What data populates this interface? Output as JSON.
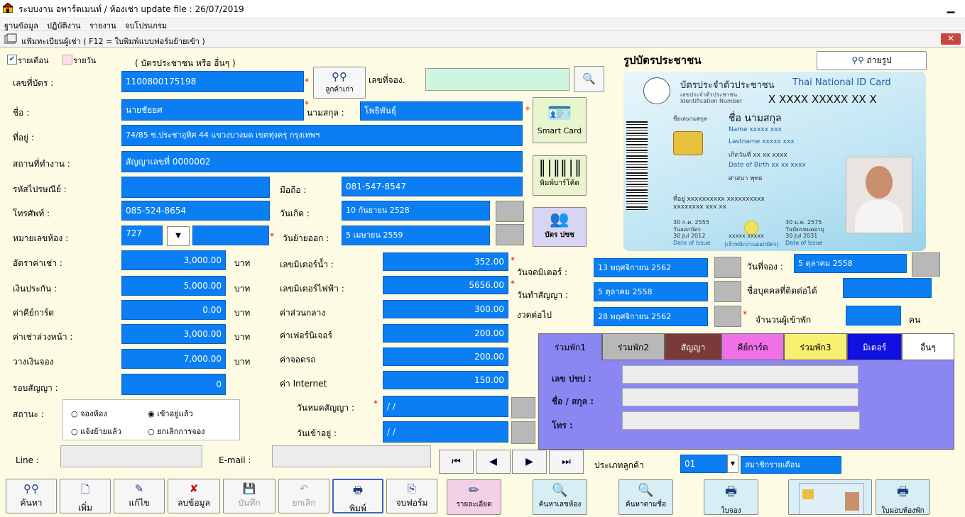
{
  "window": {
    "title": "ระบบงาน อพาร์ตเมนท์ / ห้องเช่า update file : 26/07/2019",
    "min": "▁"
  },
  "menu": [
    "ฐานข้อมูล",
    "ปฏิบัติงาน",
    "รายงาน",
    "จบโปรแกรม"
  ],
  "form": {
    "title": "แฟ้มทะเบียนผู้เช่า ( F12 = ใบพิมพ์แบบฟอร์มย้ายเข้า )",
    "close": "✕"
  },
  "mode": {
    "monthly": "รายเดือน",
    "daily": "รายวัน",
    "hint": "( บัตรประชาชน หรือ อื่นๆ )"
  },
  "labels": {
    "card_no": "เลขที่บัตร :",
    "first_name": "ชื่อ :",
    "surname": "นามสกุล :",
    "address": "ที่อยู่ :",
    "workplace": "สถานที่ทำงาน :",
    "postcode": "รหัสไปรษณีย์ :",
    "mobile": "มือถือ :",
    "phone": "โทรศัพท์ :",
    "birthday": "วันเกิด :",
    "room": "หมายเลขห้อง :",
    "move_out": "วันย้ายออก :",
    "rent": "อัตราค่าเช่า :",
    "deposit": "เงินประกัน :",
    "keycard": "ค่าคีย์การ์ด",
    "advance": "ค่าเช่าล่วงหน้า :",
    "booking_money": "วางเงินจอง",
    "round": "รอบสัญญา :",
    "status": "สถานะ :",
    "water": "เลขมิเตอร์น้ำ :",
    "electric": "เลขมิเตอร์ไฟฟ้า :",
    "common": "ค่าส่วนกลาง",
    "furniture": "ค่าเฟอร์นิเจอร์",
    "parking": "ค่าจอดรถ",
    "internet": "ค่า Internet",
    "contract_end": "วันหมดสัญญา :",
    "move_in": "วันเข้าอยู่ :",
    "booking_no": "เลขที่จอง.",
    "meter_date": "วันจดมิเตอร์ :",
    "contract_date": "วันทำสัญญา :",
    "next_due": "งวดต่อไป",
    "booking_date": "วันที่จอง :",
    "contact": "ชื่อบุคคลที่ติดต่อได้",
    "occupants": "จำนวนผู้เข้าพัก",
    "person_unit": "คน",
    "baht": "บาท",
    "line": "Line :",
    "email": "E-mail :",
    "customer_type": "ประเภทลูกค้า",
    "idcard_title": "รูปบัตรประชาชน"
  },
  "values": {
    "card_no": "1100800175198",
    "first_name": "นายชัยยศ",
    "surname": "โพธิพันธุ์",
    "address": "74/85 ซ.ประชาอุทิศ 44 แขวงบางมด เขตทุ่งครุ กรุงเทพฯ",
    "workplace": "สัญญาเลขที่ 0000002",
    "postcode": "",
    "mobile": "081-547-8547",
    "phone": "085-524-8654",
    "birthday": "10 กันยายน 2528",
    "room": "727",
    "room_extra": "",
    "move_out": "5 เมษายน 2559",
    "rent": "3,000.00",
    "deposit": "5,000.00",
    "keycard": "0.00",
    "advance": "3,000.00",
    "booking_money": "7,000.00",
    "round": "0",
    "water": "352.00",
    "electric": "5656.00",
    "common": "300.00",
    "furniture": "200.00",
    "parking": "200.00",
    "internet": "150.00",
    "contract_end": "  /  /",
    "move_in": "  /  /",
    "booking_no": "",
    "meter_date": "13 พฤศจิกายน 2562",
    "contract_date": "5 ตุลาคม 2558",
    "next_due": "28 พฤศจิกายน 2562",
    "booking_date": "5 ตุลาคม 2558",
    "contact": "",
    "occupants": "",
    "line": "",
    "email": "",
    "customer_type_code": "01",
    "customer_type_name": "สมาชิกรายเดือน"
  },
  "status_options": [
    "จองห้อง",
    "เข้าอยู่แล้ว",
    "แจ้งย้ายแล้ว",
    "ยกเลิกการจอง"
  ],
  "side_buttons": {
    "search_old": "ลูกค้าเก่า",
    "smart_card": "Smart Card",
    "barcode": "พิมพ์บาร์โค้ด",
    "id_card": "บัตร ปชช",
    "photo": "ถ่ายรูป"
  },
  "tabs": [
    {
      "label": "ร่วมพัก1",
      "color": "#8b87f2"
    },
    {
      "label": "ร่วมพัก2",
      "color": "#b8b8b8"
    },
    {
      "label": "สัญญา",
      "color": "#7a3a3a"
    },
    {
      "label": "คีย์การ์ด",
      "color": "#f070e8"
    },
    {
      "label": "ร่วมพัก3",
      "color": "#f8f070"
    },
    {
      "label": "มิเตอร์",
      "color": "#1010e0"
    },
    {
      "label": "อื่นๆ",
      "color": "#ffffff"
    }
  ],
  "tab_panel": {
    "id_label": "เลข ปชป :",
    "name_label": "ชื่อ / สกุล :",
    "phone_label": "โทร :"
  },
  "idcard": {
    "header_th": "บัตรประจำตัวประชาชน",
    "header_en": "Thai National ID Card",
    "id_label_th": "เลขประจำตัวประชาชน",
    "id_label_en": "Identification Number",
    "id_number": "X XXXX XXXXX XX X",
    "name_label_th": "ชื่อเลนามสกุล",
    "name_th": "ชื่อ  นามสกุล",
    "name_en": "Name  xxxxx  xxx",
    "lastname_en": "Lastname  xxxxx  xxx",
    "birth_th": "เกิดวันที่  xx  xx  xxxx",
    "birth_en": "Date of Birth  xx xx xxxx",
    "religion": "ศาสนา  พุทธ",
    "address": "ที่อยู่  xxxxxxxxxx  xxxxxxxxxx",
    "address2": "xxxxxxxx xxx xx",
    "issue_th": "30 ก.ค. 2555",
    "issue_label_th": "วันออกบัตร",
    "issue_en": "30 Jul 2012",
    "issue_label_en": "Date of Issue",
    "exp_th": "30 ม.ค. 2575",
    "exp_label_th": "วันบัตรหมดอายุ",
    "exp_en": "30 Jul 2031",
    "exp_label_en": "Date of Issue",
    "officer": "xxxxx xxxxx",
    "officer_label": "(เจ้าพนักงานออกบัตร)"
  },
  "toolbar": [
    "ค้นหา",
    "เพิ่ม",
    "แก้ไข",
    "ลบข้อมูล",
    "บันทึก",
    "ยกเลิก",
    "พิมพ์",
    "จบฟอร์ม"
  ],
  "action_buttons": [
    "รายละเอียด",
    "ค้นหาเลขห้อง",
    "ค้นหาตามชื่อ",
    "ใบจอง",
    "",
    "ใบมอบห้องพัก"
  ],
  "nav": [
    "⏮",
    "◀",
    "▶",
    "⏭"
  ]
}
